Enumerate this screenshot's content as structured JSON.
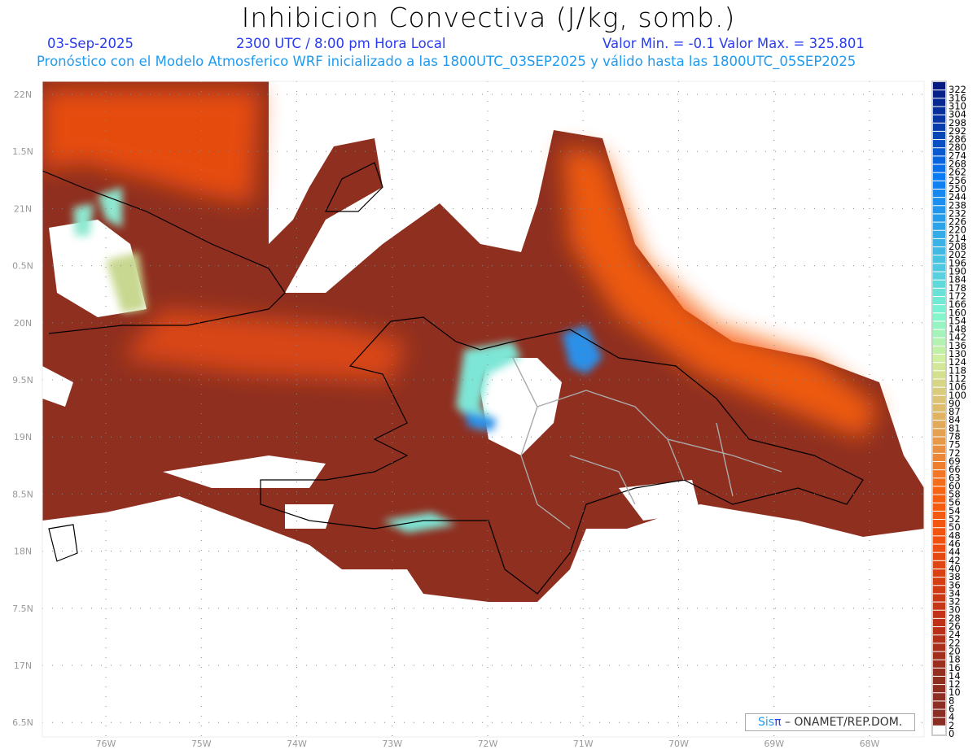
{
  "header": {
    "title": "Inhibicion Convectiva (J/kg, somb.)",
    "date": "03-Sep-2025",
    "time": "2300 UTC / 8:00 pm Hora Local",
    "minmax": "Valor Min. = -0.1  Valor Max. = 325.801",
    "model_info": "Pronóstico con el Modelo Atmosferico WRF inicializado a las 1800UTC_03SEP2025 y válido hasta las  1800UTC_05SEP2025"
  },
  "map": {
    "lat_labels": [
      "22N",
      "1.5N",
      "21N",
      "0.5N",
      "20N",
      "9.5N",
      "19N",
      "8.5N",
      "18N",
      "7.5N",
      "17N",
      "6.5N"
    ],
    "lon_labels": [
      "76W",
      "75W",
      "74W",
      "73W",
      "72W",
      "71W",
      "70W",
      "69W",
      "68W"
    ],
    "colors": {
      "land_low": "#8f2f20",
      "mid": "#d9480f",
      "high": "#ff6a10",
      "cyan": "#7ee6d6",
      "blue": "#1e70e0",
      "no_data": "#ffffff"
    }
  },
  "colorbar": {
    "labels": [
      "322",
      "316",
      "310",
      "304",
      "298",
      "292",
      "286",
      "280",
      "274",
      "268",
      "262",
      "256",
      "250",
      "244",
      "238",
      "232",
      "226",
      "220",
      "214",
      "208",
      "202",
      "196",
      "190",
      "184",
      "178",
      "172",
      "166",
      "160",
      "154",
      "148",
      "142",
      "136",
      "130",
      "124",
      "118",
      "112",
      "106",
      "100",
      "90",
      "87",
      "84",
      "81",
      "78",
      "75",
      "72",
      "69",
      "66",
      "63",
      "60",
      "58",
      "56",
      "54",
      "52",
      "50",
      "48",
      "46",
      "44",
      "42",
      "40",
      "38",
      "36",
      "34",
      "32",
      "30",
      "28",
      "26",
      "24",
      "22",
      "20",
      "18",
      "16",
      "14",
      "12",
      "10",
      "8",
      "6",
      "4",
      "2",
      "0"
    ],
    "color_stops": [
      "#061a80",
      "#0a40b0",
      "#0a7af5",
      "#2aa0e8",
      "#50c8e0",
      "#80f5d0",
      "#d0f0a0",
      "#dcc070",
      "#e89040",
      "#f86010",
      "#f05010",
      "#d03c14",
      "#b83018",
      "#8f2f20",
      "#8a2e24"
    ]
  },
  "credit": {
    "sis": "Sis",
    "pi": "π",
    "rest": " –  ONAMET/REP.DOM."
  }
}
